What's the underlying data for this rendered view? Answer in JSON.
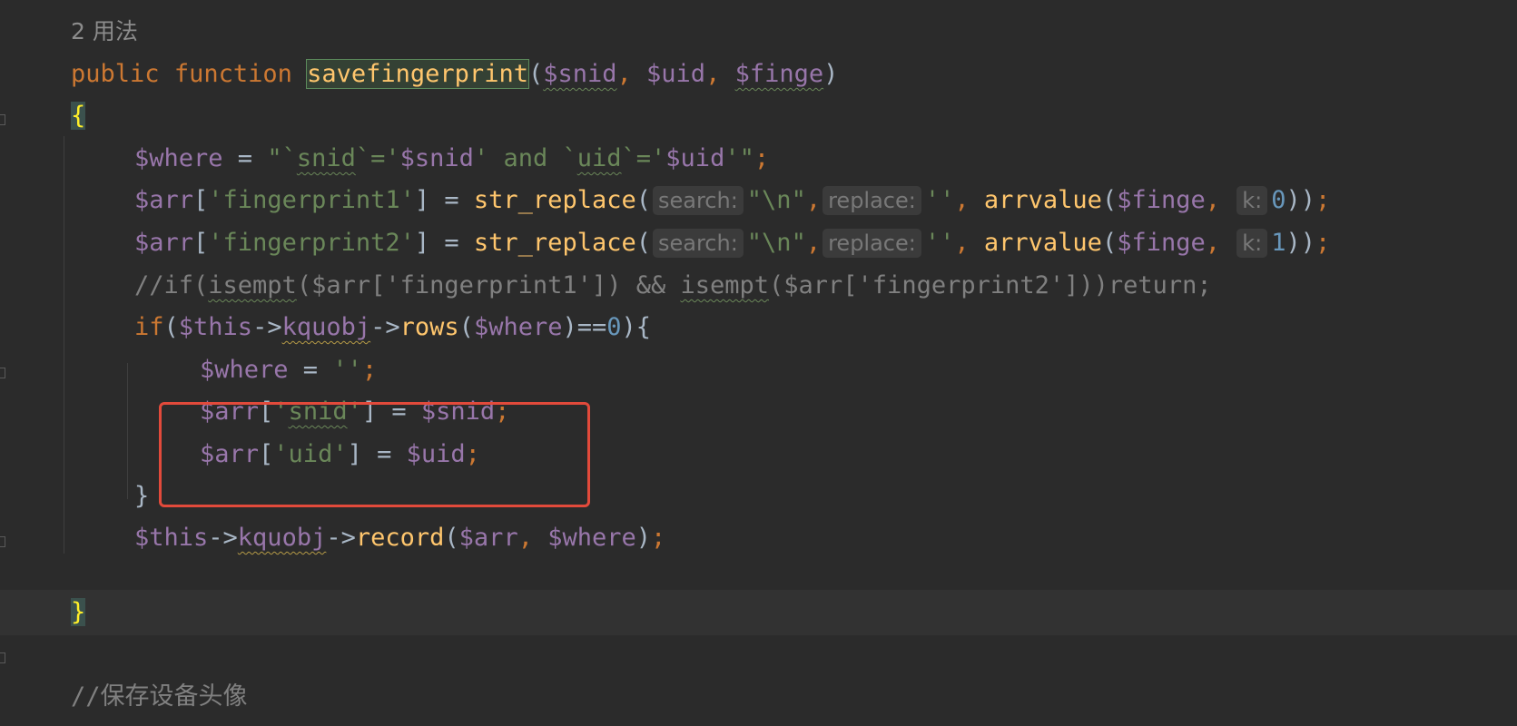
{
  "usage_hint": "2 用法",
  "lines": {
    "l1": {
      "kw1": "public",
      "kw2": "function",
      "fname": "savefingerprint",
      "p1": "$snid",
      "p2": "$uid",
      "p3": "$finge"
    },
    "l2": {
      "brace": "{"
    },
    "l3": {
      "var": "$where",
      "str1": "\"`",
      "sq1": "snid",
      "str2": "`='",
      "var2": "$snid",
      "str3": "' and `",
      "sq2": "uid",
      "str4": "`='",
      "var3": "$uid",
      "str5": "'\""
    },
    "l4": {
      "var": "$arr",
      "key": "'fingerprint1'",
      "fn": "str_replace",
      "hint1": "search:",
      "s1": "\"\\n\"",
      "hint2": "replace:",
      "s2": "''",
      "fn2": "arrvalue",
      "arg": "$finge",
      "hint3": "k:",
      "num": "0"
    },
    "l5": {
      "var": "$arr",
      "key": "'fingerprint2'",
      "fn": "str_replace",
      "hint1": "search:",
      "s1": "\"\\n\"",
      "hint2": "replace:",
      "s2": "''",
      "fn2": "arrvalue",
      "arg": "$finge",
      "hint3": "k:",
      "num": "1"
    },
    "l6": {
      "c1": "//if(",
      "c2": "isempt",
      "c3": "($arr['fingerprint1']) && ",
      "c4": "isempt",
      "c5": "($arr['fingerprint2']))return;"
    },
    "l7": {
      "kw": "if",
      "var": "$this",
      "obj": "kquobj",
      "fn": "rows",
      "arg": "$where",
      "num": "0"
    },
    "l8": {
      "var": "$where",
      "str": "''"
    },
    "l9": {
      "var": "$arr",
      "q1": "'",
      "key": "snid",
      "q2": "'",
      "var2": "$snid"
    },
    "l10": {
      "var": "$arr",
      "key": "'uid'",
      "var2": "$uid"
    },
    "l11": {
      "brace": "}"
    },
    "l12": {
      "var": "$this",
      "obj": "kquobj",
      "fn": "record",
      "a1": "$arr",
      "a2": "$where"
    },
    "l13": {
      "brace": "}"
    }
  },
  "partial_comment": "//保存设备头像"
}
